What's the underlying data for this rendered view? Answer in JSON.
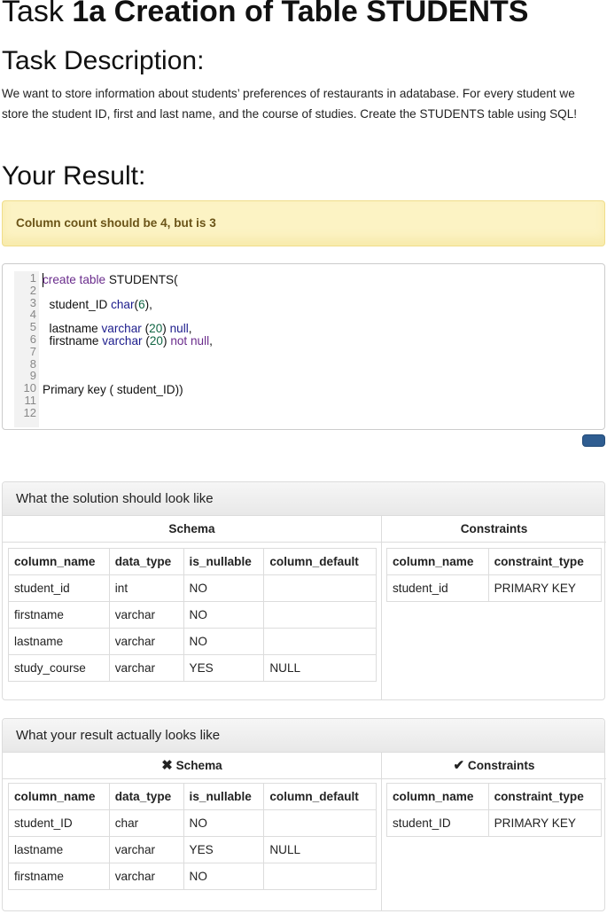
{
  "task": {
    "prefix": "Task",
    "name": "1a Creation of Table STUDENTS"
  },
  "description": {
    "heading": "Task Description:",
    "text": "We want to store information about students’ preferences of restaurants in adatabase. For every student we store the student ID, first and last name, and the course of studies. Create the STUDENTS table using SQL!"
  },
  "result": {
    "heading": "Your Result:",
    "alert": "Column count should be 4, but is 3"
  },
  "editor": {
    "line_numbers": [
      "1",
      "2",
      "3",
      "4",
      "5",
      "6",
      "7",
      "8",
      "9",
      "10",
      "11",
      "12"
    ],
    "lines": [
      [
        {
          "t": "create table",
          "c": "kw"
        },
        {
          "t": " STUDENTS(",
          "c": ""
        }
      ],
      [],
      [
        {
          "t": "  student_ID ",
          "c": ""
        },
        {
          "t": "char",
          "c": "ty"
        },
        {
          "t": "(",
          "c": ""
        },
        {
          "t": "6",
          "c": "num"
        },
        {
          "t": "),",
          "c": ""
        }
      ],
      [],
      [
        {
          "t": "  lastname ",
          "c": ""
        },
        {
          "t": "varchar",
          "c": "ty"
        },
        {
          "t": " (",
          "c": ""
        },
        {
          "t": "20",
          "c": "num"
        },
        {
          "t": ") ",
          "c": ""
        },
        {
          "t": "null",
          "c": "ty"
        },
        {
          "t": ",",
          "c": ""
        }
      ],
      [
        {
          "t": "  firstname ",
          "c": ""
        },
        {
          "t": "varchar",
          "c": "ty"
        },
        {
          "t": " (",
          "c": ""
        },
        {
          "t": "20",
          "c": "num"
        },
        {
          "t": ") ",
          "c": ""
        },
        {
          "t": "not null",
          "c": "kw"
        },
        {
          "t": ",",
          "c": ""
        }
      ],
      [],
      [],
      [],
      [
        {
          "t": "Primary key ( student_ID))",
          "c": ""
        }
      ],
      [],
      []
    ]
  },
  "expected": {
    "title": "What the solution should look like",
    "schema_title": "Schema",
    "constraints_title": "Constraints",
    "schema_headers": [
      "column_name",
      "data_type",
      "is_nullable",
      "column_default"
    ],
    "schema_rows": [
      [
        "student_id",
        "int",
        "NO",
        ""
      ],
      [
        "firstname",
        "varchar",
        "NO",
        ""
      ],
      [
        "lastname",
        "varchar",
        "NO",
        ""
      ],
      [
        "study_course",
        "varchar",
        "YES",
        "NULL"
      ]
    ],
    "constraint_headers": [
      "column_name",
      "constraint_type"
    ],
    "constraint_rows": [
      [
        "student_id",
        "PRIMARY KEY"
      ]
    ]
  },
  "actual": {
    "title": "What your result actually looks like",
    "schema_title": "Schema",
    "schema_icon": "cross-icon",
    "constraints_title": "Constraints",
    "constraints_icon": "check-icon",
    "schema_headers": [
      "column_name",
      "data_type",
      "is_nullable",
      "column_default"
    ],
    "schema_rows": [
      [
        "student_ID",
        "char",
        "NO",
        ""
      ],
      [
        "lastname",
        "varchar",
        "YES",
        "NULL"
      ],
      [
        "firstname",
        "varchar",
        "NO",
        ""
      ]
    ],
    "constraint_headers": [
      "column_name",
      "constraint_type"
    ],
    "constraint_rows": [
      [
        "student_ID",
        "PRIMARY KEY"
      ]
    ]
  },
  "colors": {
    "alert_bg": "#fcf3c4",
    "alert_text": "#6b5418",
    "button": "#2f5d91"
  }
}
